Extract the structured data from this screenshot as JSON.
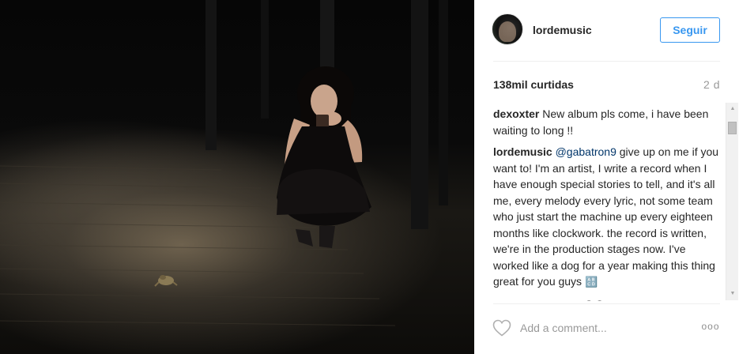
{
  "photo": {
    "alt_icon": "photo-night-frog"
  },
  "post": {
    "username": "lordemusic",
    "follow_label": "Seguir",
    "likes": "138mil curtidas",
    "time_ago": "2 d"
  },
  "comments": [
    {
      "user": "dexoxter",
      "text": "New album pls come, i have been waiting to long !!"
    },
    {
      "user": "lordemusic",
      "mention": "@gabatron9",
      "text": "give up on me if you want to! I'm an artist, I write a record when I have enough special stories to tell, and it's all me, every melody every lyric, not some team who just start the machine up every eighteen months like clockwork. the record is written, we're in the production stages now. I've worked like a dog for a year making this thing great for you guys",
      "emoji": "🔠"
    },
    {
      "user": "lpaolahernandez",
      "emoji": "😍😍"
    }
  ],
  "composer": {
    "placeholder": "Add a comment...",
    "more_label": "ooo"
  },
  "colors": {
    "accent": "#3897f0",
    "mention": "#003569",
    "text": "#262626",
    "muted": "#999999"
  },
  "icons": {
    "like": "heart-outline-icon",
    "more": "more-options-icon"
  }
}
